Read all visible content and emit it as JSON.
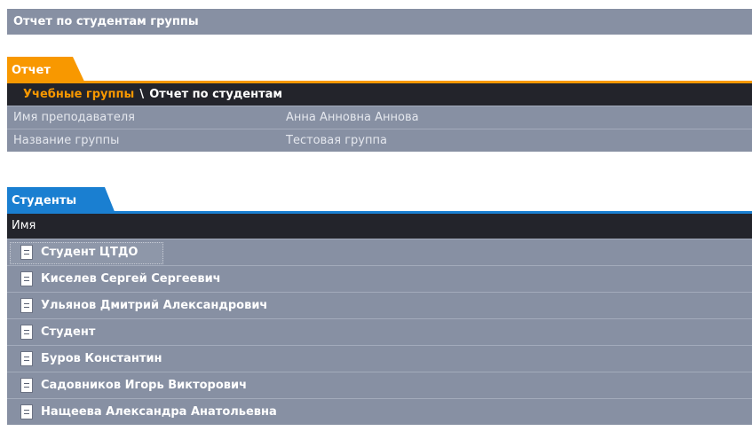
{
  "page_title": "Отчет по студентам группы",
  "report": {
    "tab_label": "Отчет",
    "breadcrumb": {
      "link": "Учебные группы",
      "separator": "\\",
      "current": "Отчет по студентам"
    },
    "rows": [
      {
        "label": "Имя преподавателя",
        "value": "Анна Анновна Аннова"
      },
      {
        "label": "Название группы",
        "value": "Тестовая группа"
      }
    ]
  },
  "students": {
    "tab_label": "Студенты",
    "column_header": "Имя",
    "rows": [
      "Студент ЦТДО",
      "Киселев Сергей Сергеевич",
      "Ульянов Дмитрий Александрович",
      "Студент",
      "Буров Константин",
      "Садовников Игорь Викторович",
      "Нащеева Александра Анатольевна"
    ]
  },
  "colors": {
    "report_tab": "#f89800",
    "students_tab": "#1a7fd1",
    "row_background": "#8790a3",
    "header_background": "#23242b"
  }
}
